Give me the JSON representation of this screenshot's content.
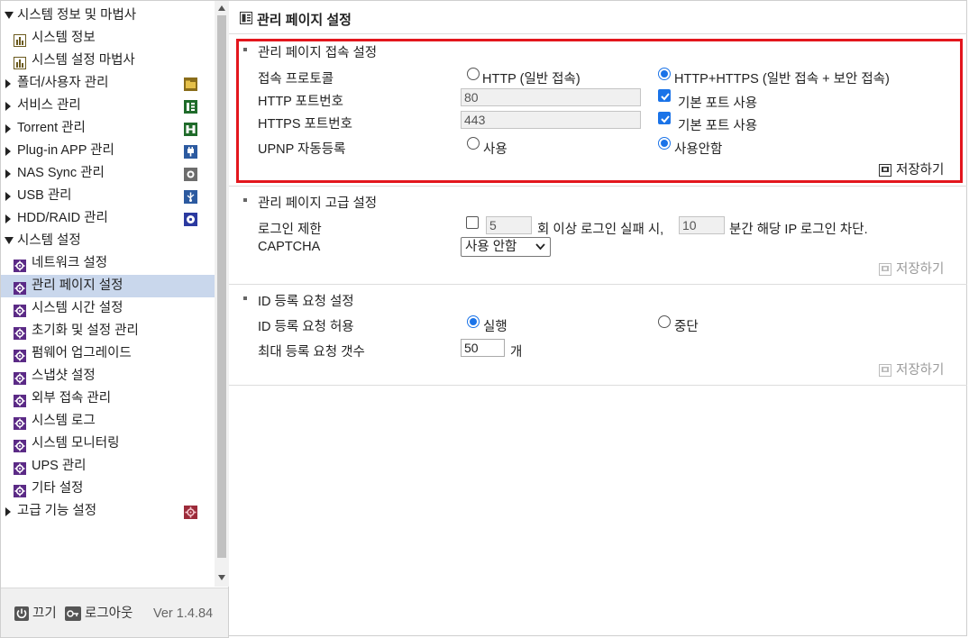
{
  "sidebar": {
    "items": [
      {
        "label": "시스템 정보 및 마법사",
        "level": "top",
        "expanded": true,
        "icon": "none"
      },
      {
        "label": "시스템 정보",
        "level": "child",
        "icon": "bar-chart-icon"
      },
      {
        "label": "시스템 설정 마법사",
        "level": "child",
        "icon": "bar-chart-icon"
      },
      {
        "label": "폴더/사용자 관리",
        "level": "top",
        "expanded": false,
        "icon": "folder-user-icon"
      },
      {
        "label": "서비스 관리",
        "level": "top",
        "expanded": false,
        "icon": "service-icon"
      },
      {
        "label": "Torrent 관리",
        "level": "top",
        "expanded": false,
        "icon": "torrent-icon"
      },
      {
        "label": "Plug-in APP 관리",
        "level": "top",
        "expanded": false,
        "icon": "plugin-icon"
      },
      {
        "label": "NAS Sync 관리",
        "level": "top",
        "expanded": false,
        "icon": "sync-icon"
      },
      {
        "label": "USB 관리",
        "level": "top",
        "expanded": false,
        "icon": "usb-icon"
      },
      {
        "label": "HDD/RAID 관리",
        "level": "top",
        "expanded": false,
        "icon": "hdd-icon"
      },
      {
        "label": "시스템 설정",
        "level": "top",
        "expanded": true,
        "icon": "none"
      },
      {
        "label": "네트워크 설정",
        "level": "child",
        "icon": "gear-icon"
      },
      {
        "label": "관리 페이지 설정",
        "level": "child",
        "icon": "gear-icon",
        "selected": true
      },
      {
        "label": "시스템 시간 설정",
        "level": "child",
        "icon": "gear-icon"
      },
      {
        "label": "초기화 및 설정 관리",
        "level": "child",
        "icon": "gear-icon"
      },
      {
        "label": "펌웨어 업그레이드",
        "level": "child",
        "icon": "gear-icon"
      },
      {
        "label": "스냅샷 설정",
        "level": "child",
        "icon": "gear-icon"
      },
      {
        "label": "외부 접속 관리",
        "level": "child",
        "icon": "gear-icon"
      },
      {
        "label": "시스템 로그",
        "level": "child",
        "icon": "gear-icon"
      },
      {
        "label": "시스템 모니터링",
        "level": "child",
        "icon": "gear-icon"
      },
      {
        "label": "UPS 관리",
        "level": "child",
        "icon": "gear-icon"
      },
      {
        "label": "기타 설정",
        "level": "child",
        "icon": "gear-icon"
      },
      {
        "label": "고급 기능 설정",
        "level": "top",
        "expanded": false,
        "icon": "advanced-icon"
      }
    ],
    "footer": {
      "power_label": "끄기",
      "logout_label": "로그아웃",
      "version": "Ver 1.4.84"
    }
  },
  "page": {
    "title": "관리 페이지 설정"
  },
  "access": {
    "title": "관리 페이지 접속 설정",
    "protocol_label": "접속 프로토콜",
    "protocol_options": [
      "HTTP (일반 접속)",
      "HTTP+HTTPS (일반 접속 + 보안 접속)"
    ],
    "protocol_selected": 1,
    "http_port_label": "HTTP 포트번호",
    "http_port_value": "80",
    "http_default_label": "기본 포트 사용",
    "https_port_label": "HTTPS 포트번호",
    "https_port_value": "443",
    "https_default_label": "기본 포트 사용",
    "upnp_label": "UPNP 자동등록",
    "upnp_options": [
      "사용",
      "사용안함"
    ],
    "upnp_selected": 1,
    "save_label": "저장하기"
  },
  "advanced": {
    "title": "관리 페이지 고급 설정",
    "login_limit_label": "로그인 제한",
    "login_count": "5",
    "login_text_1": "회 이상 로그인 실패 시,",
    "login_minutes": "10",
    "login_text_2": "분간 해당 IP 로그인 차단.",
    "captcha_label": "CAPTCHA",
    "captcha_value": "사용 안함",
    "save_label": "저장하기"
  },
  "idreq": {
    "title": "ID 등록 요청 설정",
    "allow_label": "ID 등록 요청 허용",
    "allow_options": [
      "실행",
      "중단"
    ],
    "allow_selected": 0,
    "max_label": "최대 등록 요청 갯수",
    "max_value": "50",
    "max_unit": "개",
    "save_label": "저장하기"
  },
  "colors": {
    "accent": "#1a73e8",
    "highlight": "#e3161d",
    "selected_row": "#c9d7ec"
  }
}
